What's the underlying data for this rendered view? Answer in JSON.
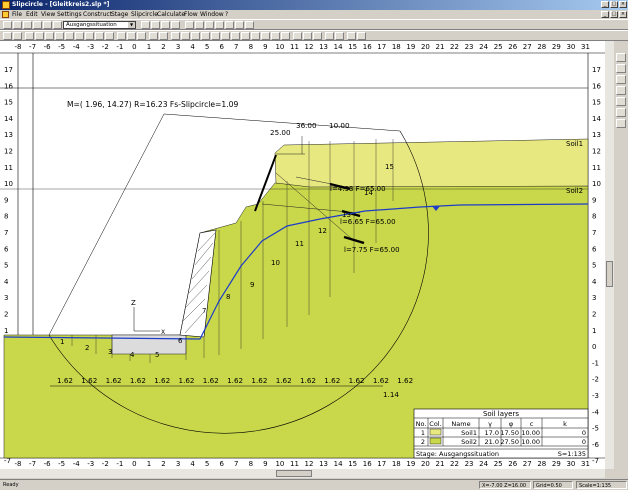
{
  "window": {
    "title": "Slipcircle - [Gleitkreis2.slp *]"
  },
  "menu": [
    "File",
    "Edit",
    "View",
    "Settings",
    "Construct",
    "Stage",
    "Slipcircle",
    "Calculate",
    "Flow",
    "Window",
    "?"
  ],
  "toolbar": {
    "stage_value": "Ausgangssituation"
  },
  "canvas": {
    "x_ticks": [
      -8,
      -7,
      -6,
      -5,
      -4,
      -3,
      -2,
      -1,
      0,
      1,
      2,
      3,
      4,
      5,
      6,
      7,
      8,
      9,
      10,
      11,
      12,
      13,
      14,
      15,
      16,
      17,
      18,
      19,
      20,
      21,
      22,
      23,
      24,
      25,
      26,
      27,
      28,
      29,
      30,
      31
    ],
    "y_ticks": [
      17,
      16,
      15,
      14,
      13,
      12,
      11,
      10,
      9,
      8,
      7,
      6,
      5,
      4,
      3,
      2,
      1,
      0,
      -1,
      -2,
      -3,
      -4,
      -5,
      -6,
      -7
    ],
    "circle_label": "M=( 1.96, 14.27) R=16.23  Fs-Slipcircle=1.09",
    "soil_labels": [
      "Soil1",
      "Soil2"
    ],
    "slices": [
      "1",
      "2",
      "3",
      "4",
      "5",
      "6",
      "7",
      "8",
      "9",
      "10",
      "11",
      "12",
      "13",
      "14",
      "15"
    ],
    "loads": [
      "l=4.93  F=65.00",
      "l=6.65  F=65.00",
      "l=7.75  F=65.00"
    ],
    "widths": [
      "1.62",
      "1.62",
      "1.62",
      "1.62",
      "1.62",
      "1.62",
      "1.62",
      "1.62",
      "1.62",
      "1.62",
      "1.62",
      "1.62",
      "1.62",
      "1.62",
      "1.62"
    ],
    "last_width": "1.14",
    "top_dims": [
      "25.00",
      "36.00",
      "10.00"
    ],
    "axis_z": "Z",
    "axis_x": "X"
  },
  "soil_table": {
    "title": "Soil layers",
    "headers": [
      "No.",
      "Col.",
      "Name",
      "γ",
      "φ",
      "c",
      "k"
    ],
    "rows": [
      {
        "no": "1",
        "name": "Soil1",
        "gamma": "17.0",
        "phi": "17.50",
        "c": "10.00",
        "k": "0",
        "color": "#e8e880"
      },
      {
        "no": "2",
        "name": "Soil2",
        "gamma": "21.0",
        "phi": "27.50",
        "c": "10.00",
        "k": "0",
        "color": "#c8d84a"
      }
    ],
    "footer_left": "Stage: Ausgangssituation",
    "footer_right": "S=1:135"
  },
  "status": {
    "ready": "Ready",
    "coords": "X=-7.00  Z=16.00",
    "grid": "Grid=0.50",
    "scale": "Scale=1:135"
  },
  "colors": {
    "soil1": "#e8e880",
    "soil2": "#c8d84a",
    "water": "#1e3cc8"
  }
}
